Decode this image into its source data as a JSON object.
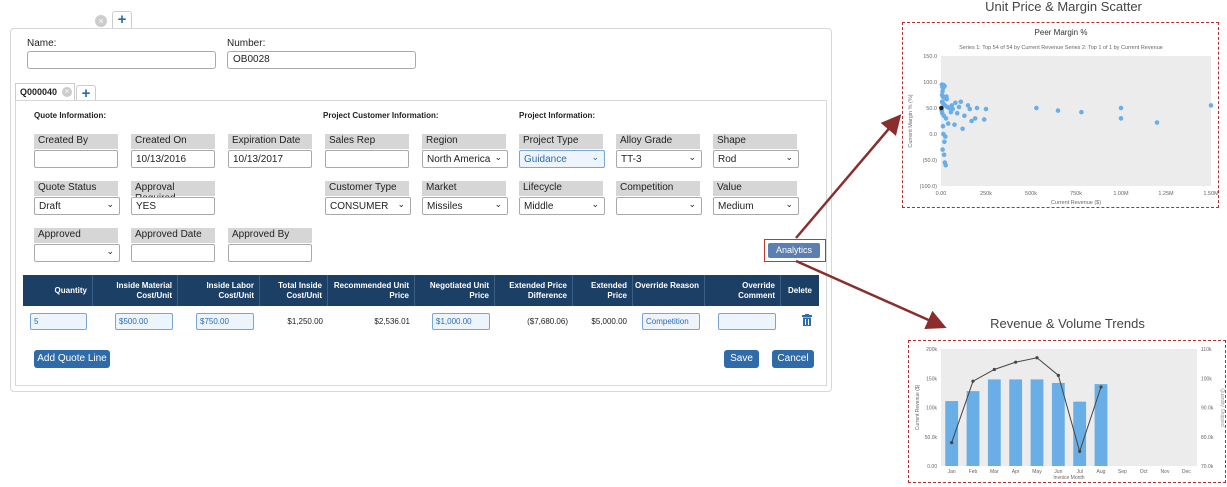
{
  "form": {
    "name_label": "Name:",
    "name_value": "",
    "number_label": "Number:",
    "number_value": "OB0028",
    "quote_tab": "Q000040"
  },
  "sections": {
    "quote_info": "Quote Information:",
    "customer_info": "Project Customer Information:",
    "project_info": "Project Information:"
  },
  "fields": {
    "created_by": {
      "label": "Created By",
      "value": ""
    },
    "created_on": {
      "label": "Created On",
      "value": "10/13/2016"
    },
    "expiration_date": {
      "label": "Expiration Date",
      "value": "10/13/2017"
    },
    "sales_rep": {
      "label": "Sales Rep",
      "value": ""
    },
    "region": {
      "label": "Region",
      "value": "North America"
    },
    "project_type": {
      "label": "Project Type",
      "value": "Guidance"
    },
    "alloy_grade": {
      "label": "Alloy Grade",
      "value": "TT-3"
    },
    "shape": {
      "label": "Shape",
      "value": "Rod"
    },
    "quote_status": {
      "label": "Quote Status",
      "value": "Draft"
    },
    "approval_required": {
      "label": "Approval Required",
      "value": "YES"
    },
    "customer_type": {
      "label": "Customer Type",
      "value": "CONSUMER"
    },
    "market": {
      "label": "Market",
      "value": "Missiles"
    },
    "lifecycle": {
      "label": "Lifecycle",
      "value": "Middle"
    },
    "competition": {
      "label": "Competition",
      "value": ""
    },
    "value": {
      "label": "Value",
      "value": "Medium"
    },
    "approved": {
      "label": "Approved",
      "value": ""
    },
    "approved_date": {
      "label": "Approved Date",
      "value": ""
    },
    "approved_by": {
      "label": "Approved By",
      "value": ""
    }
  },
  "buttons": {
    "analytics": "Analytics",
    "add_quote_line": "Add Quote Line",
    "save": "Save",
    "cancel": "Cancel"
  },
  "table": {
    "headers": [
      "Quantity",
      "Inside Material Cost/Unit",
      "Inside Labor Cost/Unit",
      "Total Inside Cost/Unit",
      "Recommended Unit Price",
      "Negotiated Unit Price",
      "Extended Price Difference",
      "Extended Price",
      "Override Reason",
      "Override Comment",
      "Delete"
    ],
    "row": {
      "quantity": "5",
      "material": "$500.00",
      "labor": "$750.00",
      "total_inside": "$1,250.00",
      "recommended": "$2,536.01",
      "negotiated": "$1,000.00",
      "ext_diff": "($7,680.06)",
      "ext_price": "$5,000.00",
      "override_reason": "Competition",
      "override_comment": ""
    }
  },
  "chart_data": [
    {
      "type": "scatter",
      "heading": "Unit Price & Margin Scatter",
      "title": "Peer Margin %",
      "subtitle": "Series 1: Top 54 of 54 by Current Revenue    Series 2: Top 1 of 1 by Current Revenue",
      "xlabel": "Current Revenue ($)",
      "ylabel": "Current Margin % (%)",
      "xlim": [
        0,
        1500000
      ],
      "ylim": [
        -100,
        150
      ],
      "xticks": [
        "0.00",
        "250k",
        "500k",
        "750k",
        "1.00M",
        "1.25M",
        "1.50M"
      ],
      "yticks": [
        "150.0",
        "100.0",
        "50.0",
        "0.0",
        "(50.0)",
        "(100.0)"
      ],
      "series": [
        {
          "points": [
            [
              5000,
              95
            ],
            [
              8000,
              90
            ],
            [
              12000,
              88
            ],
            [
              15000,
              94
            ],
            [
              20000,
              92
            ],
            [
              6000,
              75
            ],
            [
              10000,
              72
            ],
            [
              18000,
              70
            ],
            [
              25000,
              68
            ],
            [
              30000,
              72
            ],
            [
              9000,
              60
            ],
            [
              14000,
              58
            ],
            [
              22000,
              55
            ],
            [
              35000,
              52
            ],
            [
              45000,
              50
            ],
            [
              60000,
              55
            ],
            [
              80000,
              60
            ],
            [
              100000,
              52
            ],
            [
              150000,
              55
            ],
            [
              200000,
              50
            ],
            [
              250000,
              48
            ],
            [
              7000,
              40
            ],
            [
              16000,
              35
            ],
            [
              28000,
              30
            ],
            [
              55000,
              42
            ],
            [
              90000,
              40
            ],
            [
              130000,
              35
            ],
            [
              190000,
              30
            ],
            [
              240000,
              28
            ],
            [
              11000,
              15
            ],
            [
              40000,
              20
            ],
            [
              75000,
              18
            ],
            [
              120000,
              10
            ],
            [
              170000,
              25
            ],
            [
              13000,
              0
            ],
            [
              24000,
              -5
            ],
            [
              19000,
              -15
            ],
            [
              9000,
              -30
            ],
            [
              17000,
              -40
            ],
            [
              21000,
              -55
            ],
            [
              26000,
              -60
            ],
            [
              4000,
              45
            ],
            [
              6000,
              62
            ],
            [
              8500,
              82
            ],
            [
              32000,
              67
            ],
            [
              65000,
              48
            ],
            [
              110000,
              62
            ],
            [
              160000,
              48
            ],
            [
              530000,
              50
            ],
            [
              650000,
              45
            ],
            [
              780000,
              42
            ],
            [
              1000000,
              50
            ],
            [
              1000000,
              30
            ],
            [
              1200000,
              22
            ],
            [
              1500000,
              55
            ]
          ]
        },
        {
          "points": [
            [
              2000,
              50
            ]
          ]
        }
      ],
      "colors": [
        "#6aaee8",
        "#222222"
      ]
    },
    {
      "type": "bar-line",
      "heading": "Revenue & Volume Trends",
      "xlabel": "Invoice Month",
      "ylabel": "Current Revenue ($)",
      "y2label": "Quantity Shipped",
      "categories": [
        "Jan",
        "Feb",
        "Mar",
        "Apr",
        "May",
        "Jun",
        "Jul",
        "Aug",
        "Sep",
        "Oct",
        "Nov",
        "Dec"
      ],
      "ylim": [
        0,
        200000
      ],
      "y2lim": [
        70000,
        110000
      ],
      "yticks": [
        "200k",
        "150k",
        "100k",
        "50.0k",
        "0.00"
      ],
      "y2ticks": [
        "110k",
        "100k",
        "90.0k",
        "80.0k",
        "70.0k"
      ],
      "bars": [
        111000,
        128000,
        148000,
        148000,
        148000,
        142000,
        110000,
        140000,
        null,
        null,
        null,
        null
      ],
      "line": [
        78000,
        99000,
        103000,
        105500,
        107000,
        101000,
        75000,
        97000,
        null,
        null,
        null,
        null
      ],
      "colors": [
        "#6aaee8",
        "#444444"
      ]
    }
  ]
}
